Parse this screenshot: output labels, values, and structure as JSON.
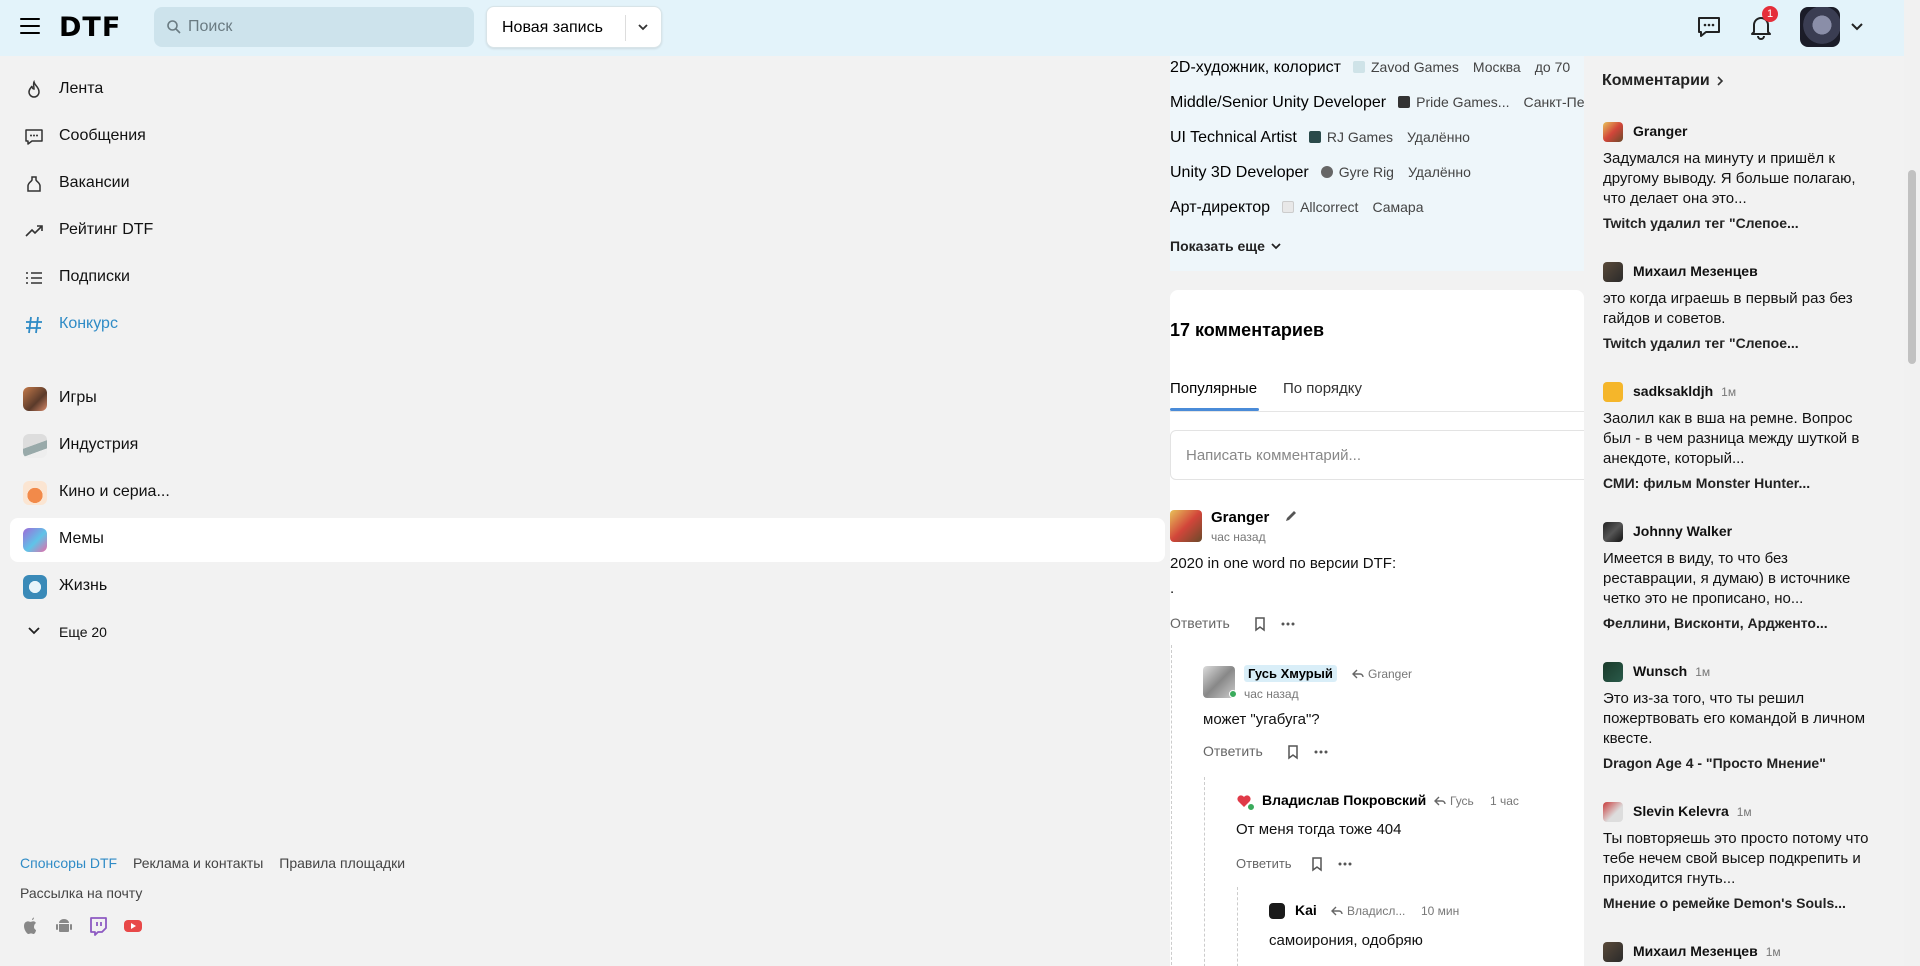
{
  "header": {
    "logo": "DTF",
    "search_placeholder": "Поиск",
    "new_post_label": "Новая запись",
    "notification_count": "1"
  },
  "sidebar": {
    "items": [
      {
        "label": "Лента",
        "icon": "flame-icon"
      },
      {
        "label": "Сообщения",
        "icon": "chat-icon"
      },
      {
        "label": "Вакансии",
        "icon": "job-icon"
      },
      {
        "label": "Рейтинг DTF",
        "icon": "trend-icon"
      },
      {
        "label": "Подписки",
        "icon": "list-icon"
      },
      {
        "label": "Конкурс",
        "icon": "hash-icon"
      }
    ],
    "subsites": [
      {
        "label": "Игры"
      },
      {
        "label": "Индустрия"
      },
      {
        "label": "Кино и сериа..."
      },
      {
        "label": "Мемы"
      },
      {
        "label": "Жизнь"
      }
    ],
    "more_label": "Еще 20",
    "footer": {
      "sponsors": "Спонсоры DTF",
      "ads": "Реклама и контакты",
      "rules": "Правила площадки",
      "mail": "Рассылка на почту"
    }
  },
  "jobs": [
    {
      "title": "2D-художник, колорист",
      "company": "Zavod Games",
      "city": "Москва",
      "salary": "до 70"
    },
    {
      "title": "Middle/Senior Unity Developer",
      "company": "Pride Games...",
      "city": "Санкт-Пе"
    },
    {
      "title": "UI Technical Artist",
      "company": "RJ Games",
      "city": "Удалённо"
    },
    {
      "title": "Unity 3D Developer",
      "company": "Gyre Rig",
      "city": "Удалённо"
    },
    {
      "title": "Арт-директор",
      "company": "Allcorrect",
      "city": "Самара"
    }
  ],
  "show_more": "Показать еще",
  "comments": {
    "title": "17 комментариев",
    "tab_popular": "Популярные",
    "tab_order": "По порядку",
    "input_placeholder": "Написать комментарий...",
    "reply_label": "Ответить",
    "items": [
      {
        "name": "Granger",
        "time": "час назад",
        "text": "2020 in one word по версии DTF:",
        "text2": "."
      },
      {
        "name": "Гусь Хмурый",
        "reply_to": "Granger",
        "time": "час назад",
        "text": "может \"угабуга\"?"
      },
      {
        "name": "Владислав Покровский",
        "reply_to": "Гусь",
        "time": "1 час",
        "text": "От меня тогда тоже 404"
      },
      {
        "name": "Kai",
        "reply_to": "Владисл...",
        "time": "10 мин",
        "text": "самоирония, одобряю"
      }
    ]
  },
  "right_sidebar": {
    "title": "Комментарии",
    "items": [
      {
        "name": "Granger",
        "time": "",
        "text": "Задумался на минуту и пришёл к другому выводу.  Я больше полагаю, что делает она это...",
        "post": "Twitch удалил тег \"Слепое..."
      },
      {
        "name": "Михаил Мезенцев",
        "time": "",
        "text": "это когда играешь в первый раз без гайдов и советов.",
        "post": "Twitch удалил тег \"Слепое..."
      },
      {
        "name": "sadksakldjh",
        "time": "1м",
        "text": "Заолил как в вша на ремне. Вопрос был - в чем разница между шуткой в анекдоте, который...",
        "post": "СМИ: фильм Monster Hunter..."
      },
      {
        "name": "Johnny Walker",
        "time": "",
        "text": "Имеется в виду, то что без реставрации, я думаю) в источнике четко это не прописано, но...",
        "post": "Феллини, Висконти, Ардженто..."
      },
      {
        "name": "Wunsch",
        "time": "1м",
        "text": "Это из-за того, что ты решил пожертвовать его командой в личном квесте.",
        "post": "Dragon Age 4 - \"Просто Мнение\""
      },
      {
        "name": "Slevin Kelevra",
        "time": "1м",
        "text": "Ты повторяешь это просто потому что тебе нечем свой высер подкрепить и приходится гнуть...",
        "post": "Мнение о ремейке Demon's Souls..."
      },
      {
        "name": "Михаил Мезенцев",
        "time": "1м",
        "text": "",
        "post": ""
      }
    ]
  },
  "colors": {
    "header_bg": "#e3f3fa",
    "accent_blue": "#2f8bc6",
    "badge_red": "#e52e3a"
  }
}
